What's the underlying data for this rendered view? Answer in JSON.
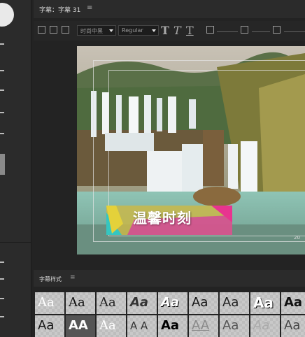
{
  "app": {
    "panel_title": "字幕：字幕 31",
    "panel_menu_glyph": "≡"
  },
  "toolbar": {
    "font_family": "时尚中黑",
    "font_style": "Regular",
    "glyphs": [
      "T",
      "T",
      "T"
    ]
  },
  "canvas": {
    "title_text": "温馨时刻",
    "corner_mark": "20",
    "colors": {
      "banner_pink": "#d63aa1",
      "banner_yellow": "#e4d13a",
      "banner_cyan": "#35c6c0"
    }
  },
  "styles_panel": {
    "title": "字幕样式",
    "menu_glyph": "≡",
    "row1": [
      "Aa",
      "Aa",
      "Aa",
      "Aa",
      "Aa",
      "Aa",
      "Aa",
      "Aa",
      "Aa"
    ],
    "row2": [
      "Aa",
      "AA",
      "Aa",
      "A A",
      "Aa",
      "AA",
      "Aa",
      "Aa",
      "Aa"
    ]
  }
}
